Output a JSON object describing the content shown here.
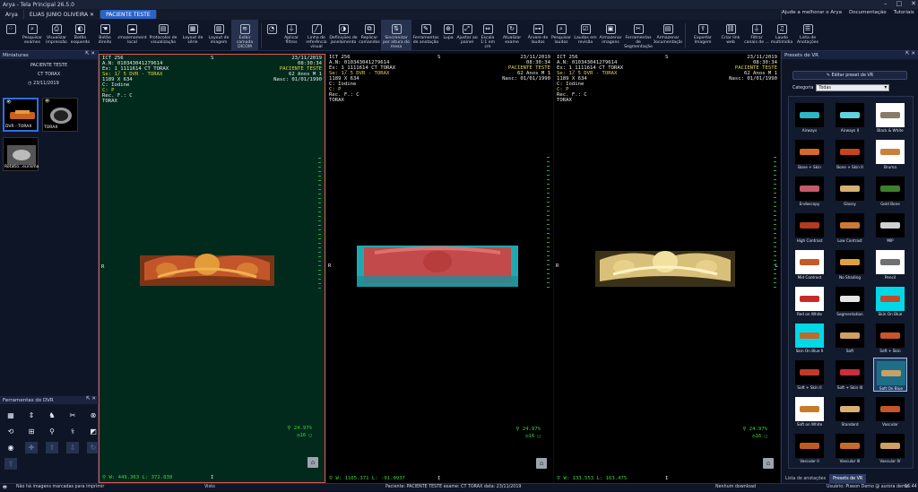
{
  "app": {
    "title": "Arya - Tela Principal 26.5.0"
  },
  "tabs": [
    {
      "label": "Arya"
    },
    {
      "label": "ELIAS JUNIO OLIVEIRA"
    },
    {
      "label": "PACIENTE TESTE"
    }
  ],
  "tab_right": {
    "help": "Ajude a melhorar o Arya",
    "docs": "Documentação",
    "tutorials": "Tutoriais"
  },
  "toolbar": [
    {
      "label": "",
      "icon": "dots-icon"
    },
    {
      "label": "Pesquisar exames",
      "icon": "search-icon"
    },
    {
      "label": "Visualizar impressão",
      "icon": "print-icon"
    },
    {
      "label": "Botão esquerdo",
      "icon": "mouse-icon"
    },
    {
      "label": "Botão direito",
      "icon": "hand-icon"
    },
    {
      "label": "Armazenamento local",
      "icon": "cloud-icon"
    },
    {
      "label": "Protocolos de visualização",
      "icon": "protocol-icon"
    },
    {
      "label": "Layout de série",
      "icon": "grid-icon"
    },
    {
      "label": "Layout de imagem",
      "icon": "grid2-icon"
    },
    {
      "label": "Exibir camada DICOM",
      "icon": "layers-icon"
    },
    {
      "label": "",
      "icon": "lens-icon"
    },
    {
      "label": "Aplicar filtros",
      "icon": "filter-icon"
    },
    {
      "label": "Linha de referência visual",
      "icon": "line-icon"
    },
    {
      "label": "Definições de janelamento",
      "icon": "window-icon"
    },
    {
      "label": "Replicar comandos",
      "icon": "replicate-icon"
    },
    {
      "label": "Sincronizar por altura do mesa",
      "icon": "sync-icon"
    },
    {
      "label": "Ferramentas de anotação",
      "icon": "annotation-icon"
    },
    {
      "label": "Lupa",
      "icon": "magnifier-icon"
    },
    {
      "label": "Ajustar ao painel",
      "icon": "fit-icon"
    },
    {
      "label": "Escala 1:1 em cm",
      "icon": "scale-icon"
    },
    {
      "label": "Atualizar exame",
      "icon": "refresh-icon"
    },
    {
      "label": "Árvore de laudos",
      "icon": "tree-icon"
    },
    {
      "label": "Pesquisar laudos",
      "icon": "search-report-icon"
    },
    {
      "label": "Laudos em revisão",
      "icon": "review-icon"
    },
    {
      "label": "Armazenar imagens",
      "icon": "save-icon"
    },
    {
      "label": "Ferramentas de Segmentação",
      "icon": "segment-icon"
    },
    {
      "label": "Armazenar Documentação",
      "icon": "doc-icon"
    },
    {
      "label": "Exportar Imagem",
      "icon": "export-icon"
    },
    {
      "label": "Criar link web",
      "icon": "link-icon"
    },
    {
      "label": "Filtrar canais de ...",
      "icon": "filter2-icon"
    },
    {
      "label": "Laudo multimídia",
      "icon": "media-icon"
    },
    {
      "label": "Lista de Anotações",
      "icon": "list-icon"
    }
  ],
  "left": {
    "miniaturas": "Miniaturas",
    "patient": "PACIENTE TESTE",
    "study": "CT TORAX",
    "date": "23/11/2019",
    "thumbs": [
      {
        "label": "DVR - TORAX"
      },
      {
        "label": "TORAX"
      },
      {
        "label": "Rotatio...eurisma"
      }
    ],
    "dvr_title": "Ferramentas do DVR"
  },
  "viewports": [
    {
      "tl": [
        "ICT 256",
        "A.N: 010343041279614",
        "Ex: 1_1111614 CT TORAX",
        "Se: 1/ 5 DVR - TORAX",
        "1189 X 634",
        "C: Iodine",
        "C: P",
        "Rec. F.: C",
        "TORAX"
      ],
      "tr": [
        "23/11/2019",
        "08:30:34",
        "PACIENTE TESTE",
        "62 Anos M 1",
        "Nasc: 01/01/1990"
      ],
      "wl": "W: 449.363 L: 372.838",
      "zoom": "24.97%",
      "frame": "16"
    },
    {
      "tl": [
        "ICT 256",
        "A.N: 010343041279614",
        "Ex: 1_1111614 CT TORAX",
        "Se: 1/ 5 DVR - TORAX",
        "1189 X 634",
        "C: Iodine",
        "C: P",
        "Rec. F.: C",
        "TORAX"
      ],
      "tr": [
        "23/11/2019",
        "08:30:34",
        "PACIENTE TESTE",
        "62 Anos M 1",
        "Nasc: 01/01/1990"
      ],
      "wl": "W: 1105.371 L: -91.0937",
      "zoom": "24.97%",
      "frame": "16"
    },
    {
      "tl": [
        "ICT 256",
        "A.N: 010343041279614",
        "Ex: 1_1111614 CT TORAX",
        "Se: 1/ 5 DVR - TORAX",
        "1189 X 634",
        "C: Iodine",
        "C: P",
        "Rec. F.: C",
        "TORAX"
      ],
      "tr": [
        "23/11/2019",
        "08:30:34",
        "PACIENTE TESTE",
        "62 Anos M 1",
        "Nasc: 01/01/1990"
      ],
      "wl": "W: 133.553 L: 163.475",
      "zoom": "24.97%",
      "frame": "16"
    }
  ],
  "orient": {
    "s": "S",
    "r": "R",
    "l": "L",
    "i": "I"
  },
  "right": {
    "title": "Presets de VR",
    "edit": "Editar preset de VR",
    "category_label": "Categoria",
    "category_value": "Todas",
    "presets": [
      {
        "name": "Airways",
        "bg": "#000000",
        "fg": "#2bb7c7"
      },
      {
        "name": "Airways II",
        "bg": "#000000",
        "fg": "#5fd4e0"
      },
      {
        "name": "Black & White",
        "bg": "#ffffff",
        "fg": "#8a7a66"
      },
      {
        "name": "Bone + Skin",
        "bg": "#000000",
        "fg": "#d8672a"
      },
      {
        "name": "Bone + Skin II",
        "bg": "#000000",
        "fg": "#c7441f"
      },
      {
        "name": "Bruma",
        "bg": "#ffffff",
        "fg": "#c9803a"
      },
      {
        "name": "Endoscopy",
        "bg": "#000000",
        "fg": "#c65a6b"
      },
      {
        "name": "Glossy",
        "bg": "#000000",
        "fg": "#d6b070"
      },
      {
        "name": "Gold Bone",
        "bg": "#000000",
        "fg": "#3d7f2d"
      },
      {
        "name": "High Contrast",
        "bg": "#000000",
        "fg": "#b63a1e"
      },
      {
        "name": "Low Contrast",
        "bg": "#000000",
        "fg": "#cf7a34"
      },
      {
        "name": "MIP",
        "bg": "#000000",
        "fg": "#d0d0d0"
      },
      {
        "name": "Mid Contrast",
        "bg": "#ffffff",
        "fg": "#c55a2a"
      },
      {
        "name": "No Shading",
        "bg": "#000000",
        "fg": "#e0a040"
      },
      {
        "name": "Pencil",
        "bg": "#ffffff",
        "fg": "#707070"
      },
      {
        "name": "Red on White",
        "bg": "#ffffff",
        "fg": "#c82a2a"
      },
      {
        "name": "Segmentation",
        "bg": "#000000",
        "fg": "#e6e6e6"
      },
      {
        "name": "Skin On Blue",
        "bg": "#00d8e8",
        "fg": "#c04a2a"
      },
      {
        "name": "Skin On Blue II",
        "bg": "#00d8e8",
        "fg": "#c06a2a"
      },
      {
        "name": "Soft",
        "bg": "#000000",
        "fg": "#d0a060"
      },
      {
        "name": "Soft + Skin",
        "bg": "#000000",
        "fg": "#c8562a"
      },
      {
        "name": "Soft + Skin II",
        "bg": "#000000",
        "fg": "#c03a2a"
      },
      {
        "name": "Soft + Skin III",
        "bg": "#000000",
        "fg": "#c8303a"
      },
      {
        "name": "Soft On Blue",
        "bg": "#1c6f86",
        "fg": "#c7a06a"
      },
      {
        "name": "Soft on White",
        "bg": "#ffffff",
        "fg": "#c87a2a"
      },
      {
        "name": "Standard",
        "bg": "#000000",
        "fg": "#d8b070"
      },
      {
        "name": "Vascular",
        "bg": "#000000",
        "fg": "#c6542a"
      },
      {
        "name": "Vascular II",
        "bg": "#000000",
        "fg": "#c05a24"
      },
      {
        "name": "Vascular III",
        "bg": "#000000",
        "fg": "#c86a2a"
      },
      {
        "name": "Vascular IV",
        "bg": "#000000",
        "fg": "#d0a060"
      }
    ],
    "tab_annotations": "Lista de anotações",
    "tab_presets": "Presets de VR"
  },
  "status": {
    "left": "Não há imagens marcadas para imprimir",
    "mid": "Visto",
    "patient": "Paciente: PACIENTE TESTE exame: CT TORAX data: 23/11/2019",
    "download": "Nenhum download",
    "user": "Usuário: Pixeon Demo @ aurora demo",
    "time": "16:44"
  },
  "colors": {
    "accent": "#2b63c7",
    "viewport_sel": "#e05555",
    "overlay_yellow": "#e5d33b",
    "overlay_green": "#3fd23f"
  }
}
